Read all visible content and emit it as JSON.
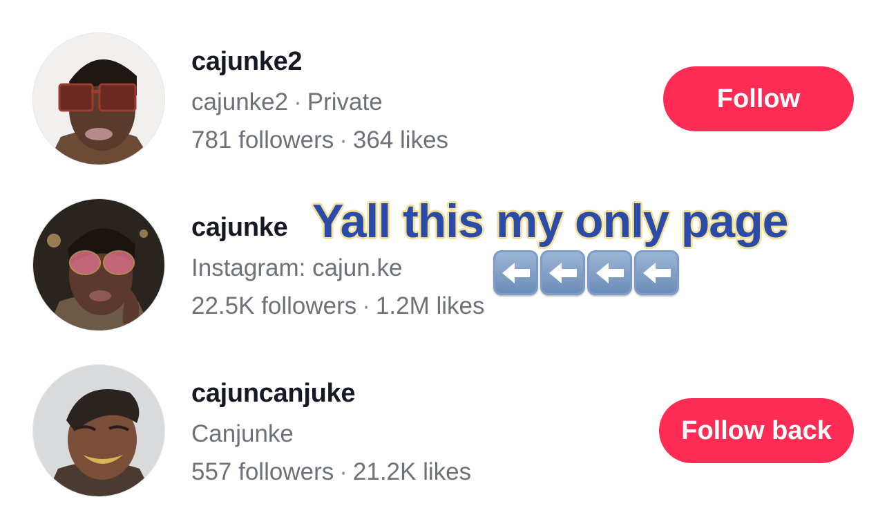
{
  "accounts": [
    {
      "username": "cajunke2",
      "subtitle_name": "cajunke2",
      "subtitle_extra": "Private",
      "followers": "781 followers",
      "likes": "364 likes",
      "button": "Follow"
    },
    {
      "username": "cajunke",
      "subtitle_name": "Instagram: cajun.ke",
      "followers": "22.5K followers",
      "likes": "1.2M likes"
    },
    {
      "username": "cajuncanjuke",
      "subtitle_name": "Canjunke",
      "followers": "557 followers",
      "likes": "21.2K likes",
      "button": "Follow back"
    }
  ],
  "overlay": {
    "caption": "Yall this my only page",
    "arrow_icon": "left-arrow-key-icon",
    "arrow_count": 4
  },
  "colors": {
    "button": "#fe2c55",
    "caption_text": "#2c4aa8",
    "caption_outline": "#f2e19a"
  }
}
